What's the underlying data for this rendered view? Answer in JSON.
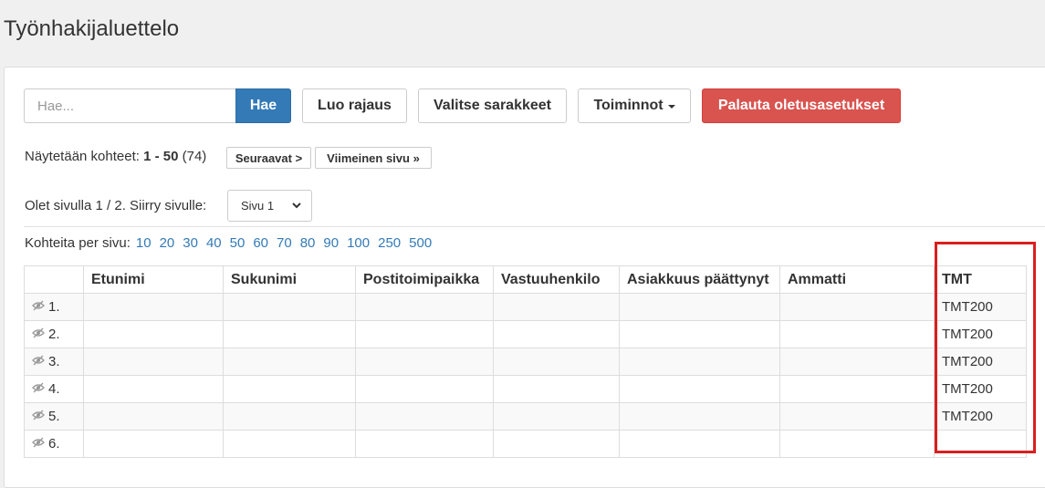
{
  "page": {
    "title": "Työnhakijaluettelo"
  },
  "toolbar": {
    "search_placeholder": "Hae...",
    "search_button": "Hae",
    "create_filter": "Luo rajaus",
    "choose_columns": "Valitse sarakkeet",
    "actions": "Toiminnot",
    "reset_defaults": "Palauta oletusasetukset",
    "colors": {
      "primary": "#337ab7",
      "danger": "#d9534f",
      "highlight": "#d91f1f"
    }
  },
  "pagination": {
    "showing_prefix": "Näytetään kohteet:",
    "showing_range": "1 - 50",
    "showing_total": "(74)",
    "next_button": "Seuraavat >",
    "last_button": "Viimeinen sivu »",
    "on_page_text": "Olet sivulla 1 / 2. Siirry sivulle:",
    "page_select_value": "Sivu 1",
    "per_page_label": "Kohteita per sivu:",
    "per_page_options": [
      "10",
      "20",
      "30",
      "40",
      "50",
      "60",
      "70",
      "80",
      "90",
      "100",
      "250",
      "500"
    ]
  },
  "table": {
    "headers": [
      "",
      "Etunimi",
      "Sukunimi",
      "Postitoimipaikka",
      "Vastuuhenkilo",
      "Asiakkuus päättynyt",
      "Ammatti",
      "TMT"
    ],
    "rows": [
      {
        "num": "1.",
        "tmt": "TMT200"
      },
      {
        "num": "2.",
        "tmt": "TMT200"
      },
      {
        "num": "3.",
        "tmt": "TMT200"
      },
      {
        "num": "4.",
        "tmt": "TMT200"
      },
      {
        "num": "5.",
        "tmt": "TMT200"
      },
      {
        "num": "6.",
        "tmt": ""
      }
    ],
    "row_icon": "hidden-eye-icon"
  }
}
